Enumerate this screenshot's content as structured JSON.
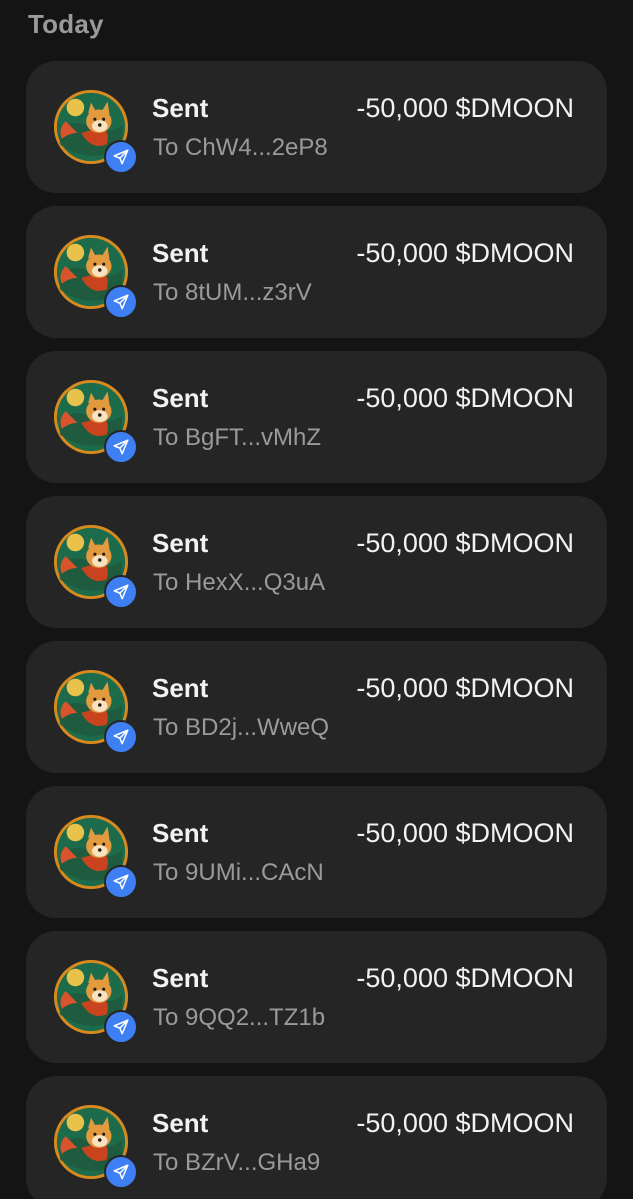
{
  "section": {
    "title": "Today"
  },
  "transactions": [
    {
      "title": "Sent",
      "amount": "-50,000 $DMOON",
      "recipient": "To ChW4...2eP8"
    },
    {
      "title": "Sent",
      "amount": "-50,000 $DMOON",
      "recipient": "To 8tUM...z3rV"
    },
    {
      "title": "Sent",
      "amount": "-50,000 $DMOON",
      "recipient": "To BgFT...vMhZ"
    },
    {
      "title": "Sent",
      "amount": "-50,000 $DMOON",
      "recipient": "To HexX...Q3uA"
    },
    {
      "title": "Sent",
      "amount": "-50,000 $DMOON",
      "recipient": "To BD2j...WweQ"
    },
    {
      "title": "Sent",
      "amount": "-50,000 $DMOON",
      "recipient": "To 9UMi...CAcN"
    },
    {
      "title": "Sent",
      "amount": "-50,000 $DMOON",
      "recipient": "To 9QQ2...TZ1b"
    },
    {
      "title": "Sent",
      "amount": "-50,000 $DMOON",
      "recipient": "To BZrV...GHa9"
    }
  ],
  "icons": {
    "token": "dmoon-token-icon",
    "badge": "send-arrow-icon"
  },
  "colors": {
    "background": "#141414",
    "card": "#252525",
    "badge": "#3e7ff3",
    "primary_text": "#f2f2f2",
    "secondary_text": "#9a9a9a"
  }
}
